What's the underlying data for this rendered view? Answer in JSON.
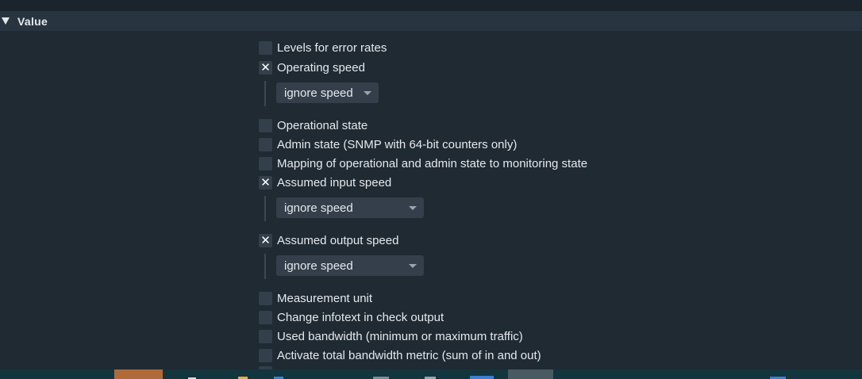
{
  "section": {
    "title": "Value"
  },
  "options": {
    "levels_error_rates": {
      "label": "Levels for error rates",
      "checked": false
    },
    "operating_speed": {
      "label": "Operating speed",
      "checked": true,
      "select": "ignore speed"
    },
    "operational_state": {
      "label": "Operational state",
      "checked": false
    },
    "admin_state": {
      "label": "Admin state (SNMP with 64-bit counters only)",
      "checked": false
    },
    "mapping_state": {
      "label": "Mapping of operational and admin state to monitoring state",
      "checked": false
    },
    "assumed_input_speed": {
      "label": "Assumed input speed",
      "checked": true,
      "select": "ignore speed"
    },
    "assumed_output_speed": {
      "label": "Assumed output speed",
      "checked": true,
      "select": "ignore speed"
    },
    "measurement_unit": {
      "label": "Measurement unit",
      "checked": false
    },
    "change_infotext": {
      "label": "Change infotext in check output",
      "checked": false
    },
    "used_bandwidth": {
      "label": "Used bandwidth (minimum or maximum traffic)",
      "checked": false
    },
    "total_bandwidth": {
      "label": "Activate total bandwidth metric (sum of in and out)",
      "checked": false
    }
  },
  "checkmark_glyph": "✕",
  "colors": {
    "background": "#1f2a33",
    "header": "#283541",
    "checkbox": "#333f4b",
    "select": "#343f4b",
    "taskbar": "#13353d"
  }
}
